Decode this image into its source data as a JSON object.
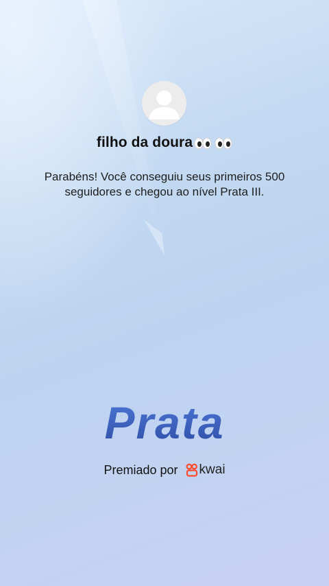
{
  "profile": {
    "username": "filho da doura",
    "username_emoji": "eyes-emoji-pair",
    "avatar_icon": "default-user-avatar-icon"
  },
  "message": "Parabéns! Você conseguiu seus primeiros 500 seguidores e chegou ao nível Prata III.",
  "level": {
    "name": "Prata",
    "color": "#3a58b8"
  },
  "footer": {
    "awarded_label": "Premiado por",
    "brand_name": "kwai",
    "brand_icon": "kwai-logo-icon",
    "brand_icon_color": "#ff4b2b"
  }
}
